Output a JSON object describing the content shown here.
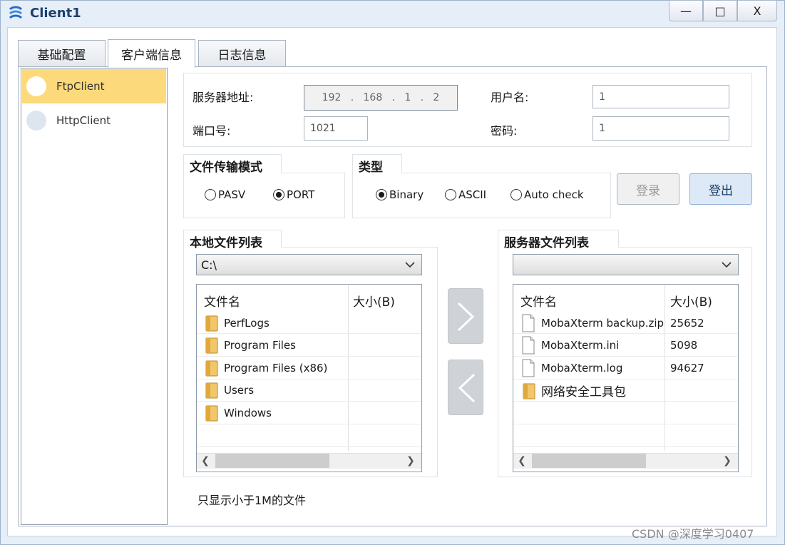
{
  "window": {
    "title": "Client1",
    "minimize_glyph": "—",
    "maximize_glyph": "□",
    "close_glyph": "X"
  },
  "tabs": [
    {
      "label": "基础配置"
    },
    {
      "label": "客户端信息",
      "active": true
    },
    {
      "label": "日志信息"
    }
  ],
  "client_list": [
    {
      "label": "FtpClient",
      "selected": true
    },
    {
      "label": "HttpClient",
      "selected": false
    }
  ],
  "connection": {
    "server_label": "服务器地址:",
    "server_ip": [
      "192",
      "168",
      "1",
      "2"
    ],
    "ip_dot": ".",
    "user_label": "用户名:",
    "user_value": "1",
    "port_label": "端口号:",
    "port_value": "1021",
    "password_label": "密码:",
    "password_value": "1"
  },
  "transfer_mode": {
    "title": "文件传输模式",
    "options": [
      {
        "label": "PASV",
        "selected": false
      },
      {
        "label": "PORT",
        "selected": true
      }
    ]
  },
  "type_group": {
    "title": "类型",
    "options": [
      {
        "label": "Binary",
        "selected": true
      },
      {
        "label": "ASCII",
        "selected": false
      },
      {
        "label": "Auto check",
        "selected": false
      }
    ]
  },
  "buttons": {
    "login": "登录",
    "logout": "登出"
  },
  "local_files": {
    "title": "本地文件列表",
    "drive": "C:\\",
    "col_name": "文件名",
    "col_size": "大小(B)",
    "items": [
      {
        "name": "PerfLogs",
        "type": "folder",
        "size": ""
      },
      {
        "name": "Program Files",
        "type": "folder",
        "size": ""
      },
      {
        "name": "Program Files (x86)",
        "type": "folder",
        "size": ""
      },
      {
        "name": "Users",
        "type": "folder",
        "size": ""
      },
      {
        "name": "Windows",
        "type": "folder",
        "size": ""
      }
    ]
  },
  "server_files": {
    "title": "服务器文件列表",
    "drive": "",
    "col_name": "文件名",
    "col_size": "大小(B)",
    "items": [
      {
        "name": "MobaXterm backup.zip",
        "type": "file",
        "size": "25652"
      },
      {
        "name": "MobaXterm.ini",
        "type": "file",
        "size": "5098"
      },
      {
        "name": "MobaXterm.log",
        "type": "file",
        "size": "94627"
      },
      {
        "name": "网络安全工具包",
        "type": "folder",
        "size": ""
      }
    ]
  },
  "note": "只显示小于1M的文件",
  "watermark": "CSDN @深度学习0407",
  "colors": {
    "selected_item": "#fcd97a",
    "window_bg": "#e6eef8",
    "title_text": "#1c3f6e"
  }
}
